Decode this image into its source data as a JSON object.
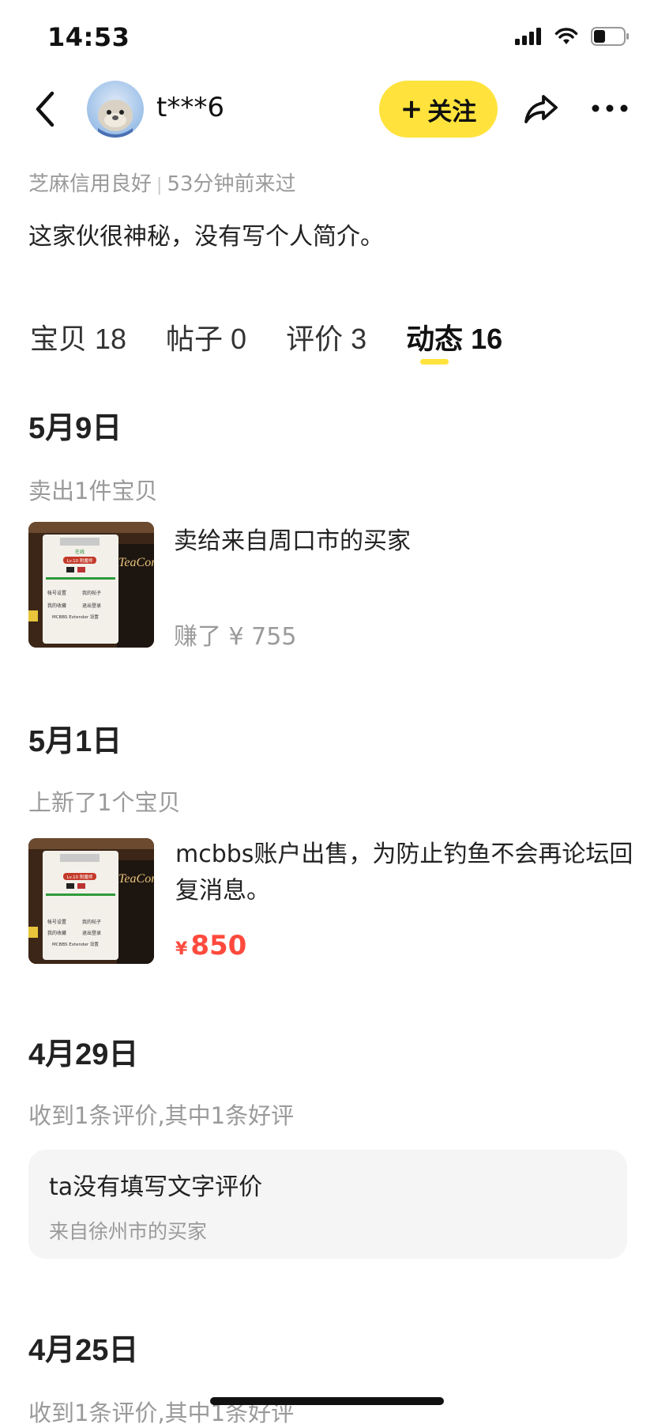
{
  "status_bar": {
    "time": "14:53"
  },
  "header": {
    "nickname": "t***6",
    "follow_label": "关注",
    "follow_plus": "+"
  },
  "profile": {
    "credit": "芝麻信用良好",
    "last_visit": "53分钟前来过",
    "intro": "这家伙很神秘，没有写个人简介。"
  },
  "tabs": [
    {
      "label": "宝贝 18",
      "active": false
    },
    {
      "label": "帖子 0",
      "active": false
    },
    {
      "label": "评价 3",
      "active": false
    },
    {
      "label": "动态 16",
      "active": true
    }
  ],
  "feed": [
    {
      "date": "5月9日",
      "action": "卖出1件宝贝",
      "item_title": "卖给来自周口市的买家",
      "earned": "赚了 ¥ 755"
    },
    {
      "date": "5月1日",
      "action": "上新了1个宝贝",
      "item_title": "mcbbs账户出售，为防止钓鱼不会再论坛回复消息。",
      "price_currency": "¥",
      "price": "850"
    },
    {
      "date": "4月29日",
      "action": "收到1条评价,其中1条好评",
      "review_text": "ta没有填写文字评价",
      "review_from": "来自徐州市的买家"
    },
    {
      "date": "4月25日",
      "action": "收到1条评价,其中1条好评"
    }
  ],
  "thumbnail": {
    "menu_items": [
      "帐号设置",
      "我的帖子",
      "我的收藏",
      "退出登录",
      "MCBBS Extender 设置"
    ],
    "badge": "Lv.10 附魔师",
    "status": "在线",
    "logo": "TeaCon"
  },
  "colors": {
    "accent_yellow": "#ffe33c",
    "price_red": "#ff4a3d",
    "muted_gray": "#9a9a9a"
  }
}
